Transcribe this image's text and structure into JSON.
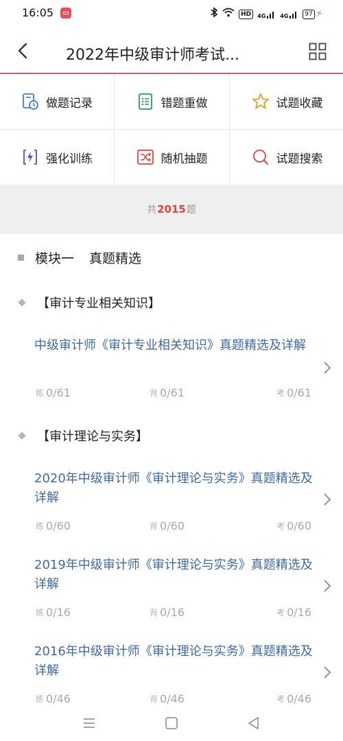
{
  "status_bar": {
    "time": "16:05",
    "hd_label": "HD",
    "signal1_label": "4G",
    "signal2_label": "4G",
    "battery_level": "97"
  },
  "header": {
    "title": "2022年中级审计师考试...",
    "back_icon": "chevron-left-icon",
    "menu_icon": "grid-icon"
  },
  "functions": [
    {
      "label": "做题记录",
      "icon": "history-icon",
      "color": "#3b7fd6"
    },
    {
      "label": "错题重做",
      "icon": "list-icon",
      "color": "#2a9a6a"
    },
    {
      "label": "试题收藏",
      "icon": "star-icon",
      "color": "#e8a020"
    },
    {
      "label": "强化训练",
      "icon": "lightning-icon",
      "color": "#5a4fcf"
    },
    {
      "label": "随机抽题",
      "icon": "shuffle-icon",
      "color": "#e0443c"
    },
    {
      "label": "试题搜索",
      "icon": "search-icon",
      "color": "#e0443c"
    }
  ],
  "count_banner": {
    "prefix": "共",
    "count": "2015",
    "suffix": "题"
  },
  "module": {
    "number": "模块一",
    "name": "真题精选"
  },
  "sections": [
    {
      "title": "【审计专业相关知识】",
      "items": [
        {
          "title": "中级审计师《审计专业相关知识》真题精选及详解",
          "practice_tag": "练",
          "practice": "0/61",
          "recite_tag": "背",
          "recite": "0/61",
          "exam_tag": "考",
          "exam": "0/61"
        }
      ]
    },
    {
      "title": "【审计理论与实务】",
      "items": [
        {
          "title": "2020年中级审计师《审计理论与实务》真题精选及详解",
          "practice_tag": "练",
          "practice": "0/60",
          "recite_tag": "背",
          "recite": "0/60",
          "exam_tag": "考",
          "exam": "0/60"
        },
        {
          "title": "2019年中级审计师《审计理论与实务》真题精选及详解",
          "practice_tag": "练",
          "practice": "0/16",
          "recite_tag": "背",
          "recite": "0/16",
          "exam_tag": "考",
          "exam": "0/16"
        },
        {
          "title": "2016年中级审计师《审计理论与实务》真题精选及详解",
          "practice_tag": "练",
          "practice": "0/46",
          "recite_tag": "背",
          "recite": "0/46",
          "exam_tag": "考",
          "exam": "0/46"
        }
      ]
    }
  ],
  "nav_bar": {
    "icons": [
      "menu-icon",
      "home-icon",
      "back-icon"
    ]
  }
}
